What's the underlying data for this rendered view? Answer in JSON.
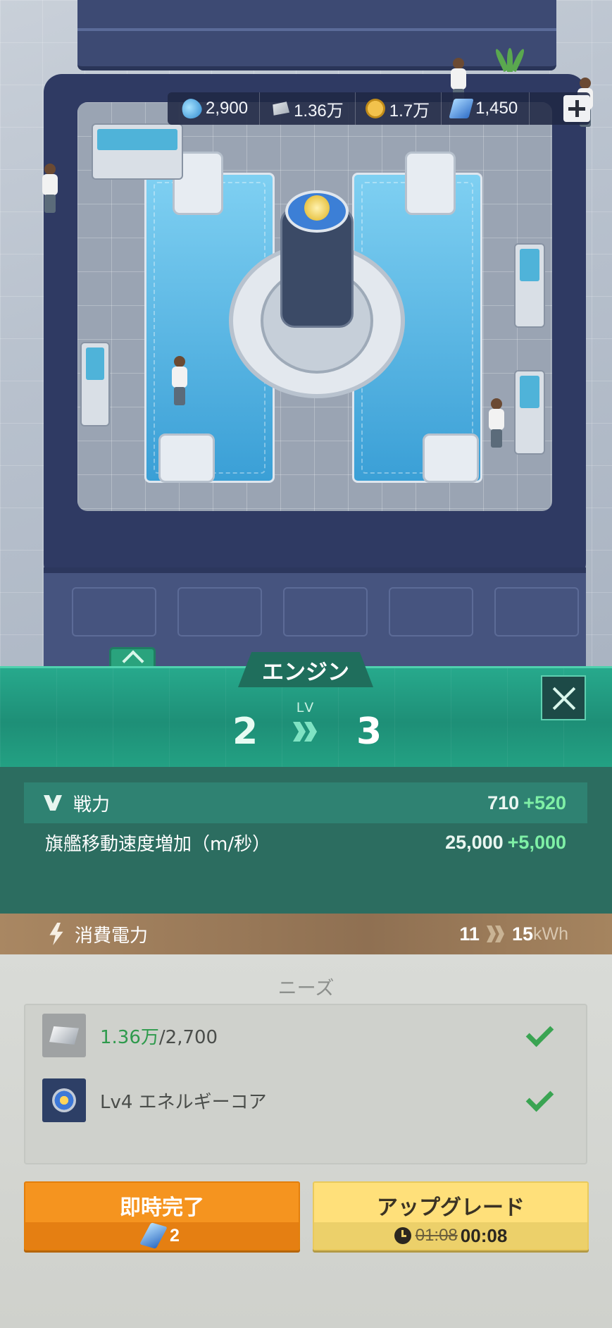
{
  "resources": [
    {
      "icon": "water-drop-icon",
      "value": "2,900"
    },
    {
      "icon": "ingot-icon",
      "value": "1.36万"
    },
    {
      "icon": "coin-icon",
      "value": "1.7万"
    },
    {
      "icon": "card-icon",
      "value": "1,450"
    }
  ],
  "panel": {
    "title": "エンジン",
    "lv_label": "LV",
    "level_from": "2",
    "level_to": "3"
  },
  "stats": [
    {
      "label": "戦力",
      "base": "710",
      "add": "+520"
    },
    {
      "label": "旗艦移動速度増加（m/秒）",
      "base": "25,000",
      "add": "+5,000"
    }
  ],
  "power": {
    "label": "消費電力",
    "from": "11",
    "to": "15",
    "unit": "kWh"
  },
  "needs": {
    "title": "ニーズ",
    "items": [
      {
        "icon": "ingot-icon",
        "have": "1.36万",
        "required": "/2,700",
        "met": true
      },
      {
        "icon": "energy-core-icon",
        "text": "Lv4 エネルギーコア",
        "met": true
      }
    ]
  },
  "buttons": {
    "instant": {
      "label": "即時完了",
      "cost": "2"
    },
    "upgrade": {
      "label": "アップグレード",
      "old_time": "01:08",
      "new_time": "00:08"
    }
  },
  "colors": {
    "panel_green": "#23a183",
    "stats_bg": "#2c6d60",
    "gain_green": "#7ff0a6",
    "power_brown": "#8f7052",
    "instant_orange": "#f5941f",
    "upgrade_yellow": "#ffe07a",
    "check_green": "#3aa452"
  }
}
